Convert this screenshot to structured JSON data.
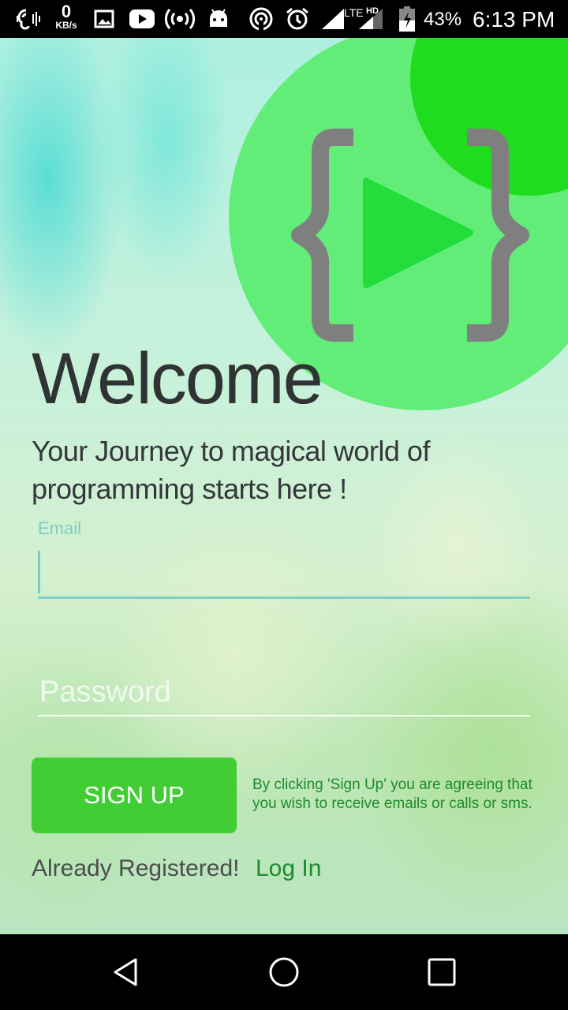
{
  "status_bar": {
    "network_speed_value": "0",
    "network_speed_unit": "KB/s",
    "network_type": "LTE",
    "network_quality": "HD",
    "battery_percent": "43%",
    "time": "6:13 PM",
    "icons": [
      "hearing-aid-icon",
      "image-icon",
      "youtube-icon",
      "hotspot-icon",
      "android-icon",
      "wifi-hotspot-icon",
      "alarm-icon",
      "signal-icon",
      "signal-hd-icon",
      "battery-charging-icon"
    ]
  },
  "app": {
    "logo": {
      "description_icon": "code-play-logo-icon",
      "colors": {
        "circle_large": "#62ed78",
        "circle_small": "#20dc1f",
        "brackets": "#7f7f7f",
        "play": "#22dd3a"
      }
    },
    "title": "Welcome",
    "tagline": "Your Journey to magical world of programming starts here !",
    "form": {
      "email_label": "Email",
      "email_value": "",
      "password_placeholder": "Password",
      "password_value": ""
    },
    "signup_button": "SIGN UP",
    "terms_text": "By clicking 'Sign Up' you are agreeing that you wish to receive emails or calls or sms.",
    "already_registered_text": "Already Registered!",
    "login_link": "Log In",
    "colors": {
      "accent": "#42cd35",
      "link": "#1e8b2c",
      "input_accent": "#7fcdc4"
    }
  },
  "nav_bar": {
    "icons": [
      "back-icon",
      "home-icon",
      "recents-icon"
    ]
  }
}
